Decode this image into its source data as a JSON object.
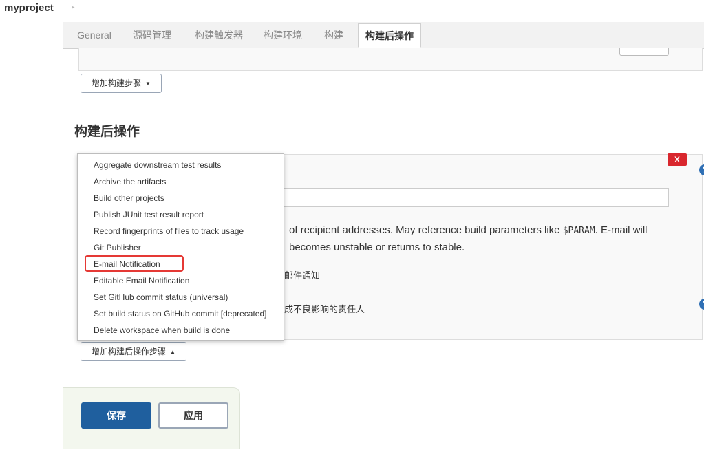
{
  "breadcrumb": {
    "project": "myproject",
    "arrow": "▸"
  },
  "tabs": [
    {
      "label": "General"
    },
    {
      "label": "源码管理"
    },
    {
      "label": "构建触发器"
    },
    {
      "label": "构建环境"
    },
    {
      "label": "构建"
    },
    {
      "label": "构建后操作"
    }
  ],
  "build": {
    "add_step_label": "增加构建步骤"
  },
  "post_build": {
    "title": "构建后操作",
    "close_label": "X",
    "help_label": "?",
    "description_line1": "of recipient addresses. May reference build parameters like ",
    "description_param": "$PARAM",
    "description_line1_end": ". E-mail will",
    "description_line2": "becomes unstable or returns to stable.",
    "checkbox1_label": "邮件通知",
    "checkbox2_label": "成不良影响的责任人",
    "add_step_label": "增加构建后操作步骤"
  },
  "menu": {
    "items": [
      {
        "label": "Aggregate downstream test results"
      },
      {
        "label": "Archive the artifacts"
      },
      {
        "label": "Build other projects"
      },
      {
        "label": "Publish JUnit test result report"
      },
      {
        "label": "Record fingerprints of files to track usage"
      },
      {
        "label": "Git Publisher"
      },
      {
        "label": "E-mail Notification"
      },
      {
        "label": "Editable Email Notification"
      },
      {
        "label": "Set GitHub commit status (universal)"
      },
      {
        "label": "Set build status on GitHub commit [deprecated]"
      },
      {
        "label": "Delete workspace when build is done"
      }
    ],
    "highlighted": "E-mail Notification",
    "highlight_color": "#e53935"
  },
  "actions": {
    "save_label": "保存",
    "apply_label": "应用"
  },
  "colors": {
    "primary": "#1f5f9e",
    "danger": "#d9272e",
    "help": "#2f6fb4"
  }
}
